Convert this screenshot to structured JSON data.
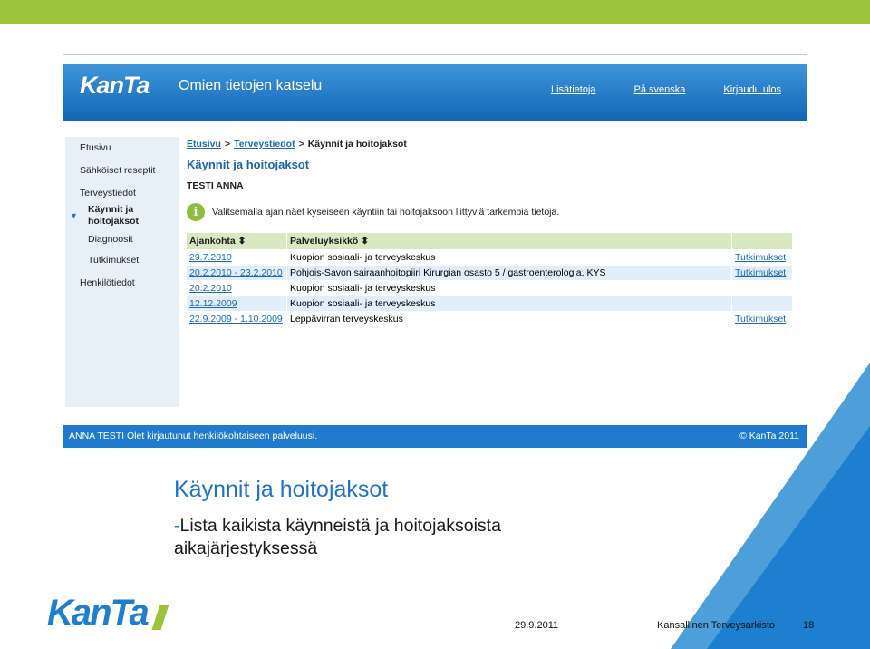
{
  "brand": {
    "logo": "KanTa",
    "accent": "#1e7fd0",
    "green": "#9cc33a"
  },
  "app": {
    "header_title": "Omien tietojen katselu",
    "header_links": [
      "Lisätietoja",
      "På svenska",
      "Kirjaudu ulos"
    ]
  },
  "sidebar": {
    "items": [
      {
        "label": "Etusivu"
      },
      {
        "label": "Sähköiset reseptit"
      },
      {
        "label": "Terveystiedot"
      },
      {
        "label": "Käynnit ja hoitojaksot"
      },
      {
        "label": "Diagnoosit"
      },
      {
        "label": "Tutkimukset"
      },
      {
        "label": "Henkilötiedot"
      }
    ]
  },
  "breadcrumb": {
    "home": "Etusivu",
    "section": "Terveystiedot",
    "current": "Käynnit ja hoitojaksot",
    "separator": ">"
  },
  "content": {
    "title": "Käynnit ja hoitojaksot",
    "patient": "TESTI ANNA",
    "info": "Valitsemalla ajan näet kyseiseen käyntiin tai hoitojaksoon liittyviä tarkempia tietoja.",
    "info_icon": "info-icon"
  },
  "table": {
    "headers": [
      "Ajankohta ⬍",
      "Palveluyksikkö ⬍",
      ""
    ],
    "rows": [
      {
        "date": "29.7.2010",
        "unit": "Kuopion sosiaali- ja terveyskeskus",
        "link": "Tutkimukset"
      },
      {
        "date": "20.2.2010 - 23.2.2010",
        "unit": "Pohjois-Savon sairaanhoitopiiri Kirurgian osasto 5 / gastroenterologia, KYS",
        "link": "Tutkimukset"
      },
      {
        "date": "20.2.2010",
        "unit": "Kuopion sosiaali- ja terveyskeskus",
        "link": ""
      },
      {
        "date": "12.12.2009",
        "unit": "Kuopion sosiaali- ja terveyskeskus",
        "link": ""
      },
      {
        "date": "22.9.2009 - 1.10.2009",
        "unit": "Leppävirran terveyskeskus",
        "link": "Tutkimukset"
      }
    ]
  },
  "footer": {
    "left": "ANNA TESTI   Olet kirjautunut henkilökohtaiseen palveluusi.",
    "right": "© KanTa 2011"
  },
  "slide": {
    "title": "Käynnit ja hoitojaksot",
    "dash": "-",
    "text": "Lista kaikista käynneistä ja hoitojaksoista aikajärjestyksessä",
    "date": "29.9.2011",
    "org": "Kansallinen Terveysarkisto",
    "page": "18"
  }
}
